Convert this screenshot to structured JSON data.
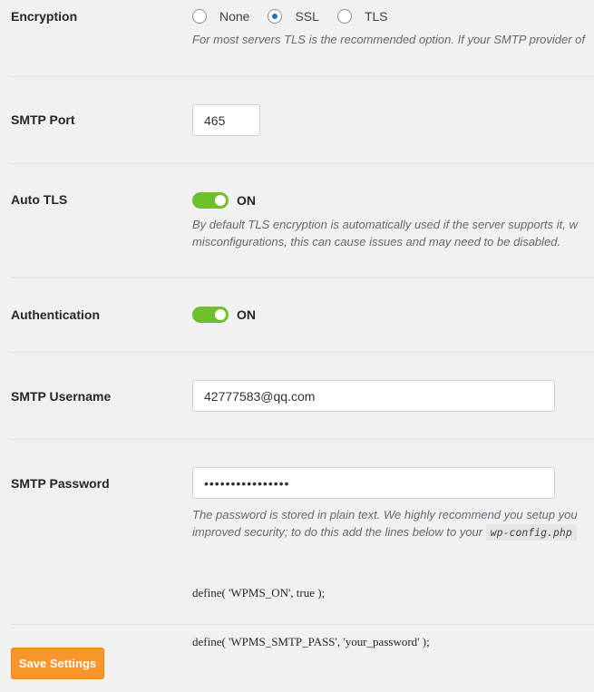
{
  "encryption": {
    "label": "Encryption",
    "options": [
      {
        "label": "None",
        "checked": false
      },
      {
        "label": "SSL",
        "checked": true
      },
      {
        "label": "TLS",
        "checked": false
      }
    ],
    "description": "For most servers TLS is the recommended option. If your SMTP provider of"
  },
  "smtp_port": {
    "label": "SMTP Port",
    "value": "465"
  },
  "auto_tls": {
    "label": "Auto TLS",
    "state": "ON",
    "description_line1": "By default TLS encryption is automatically used if the server supports it, w",
    "description_line2": "misconfigurations, this can cause issues and may need to be disabled."
  },
  "authentication": {
    "label": "Authentication",
    "state": "ON"
  },
  "smtp_username": {
    "label": "SMTP Username",
    "value": "42777583@qq.com"
  },
  "smtp_password": {
    "label": "SMTP Password",
    "value": "••••••••••••••••",
    "description_line1": "The password is stored in plain text. We highly recommend you setup you",
    "description_line2": "improved security; to do this add the lines below to your",
    "config_file": "wp-config.php",
    "code_line1": "define( 'WPMS_ON', true );",
    "code_line2": "define( 'WPMS_SMTP_PASS', 'your_password' );"
  },
  "save_button": {
    "label": "Save Settings"
  },
  "colors": {
    "toggle_on": "#6fc02c",
    "save_button": "#f7962a",
    "radio_selected": "#2271b1"
  }
}
